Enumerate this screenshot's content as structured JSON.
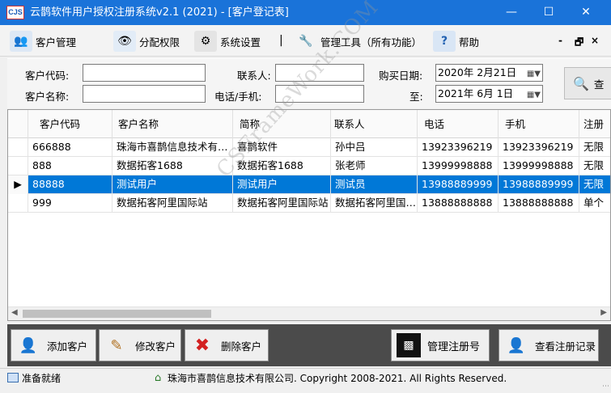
{
  "window": {
    "app_icon": "CJS",
    "title": "云鹊软件用户授权注册系统v2.1 (2021) - [客户登记表]",
    "minimize": "—",
    "maximize": "☐",
    "close": "✕"
  },
  "menu": {
    "items": [
      {
        "label": "客户管理",
        "icon": "users-star-icon"
      },
      {
        "label": "分配权限",
        "icon": "eye-permission-icon"
      },
      {
        "label": "系统设置",
        "icon": "gears-icon"
      },
      {
        "label": "管理工具（所有功能）",
        "icon": "wrench-screwdriver-icon"
      },
      {
        "label": "帮助",
        "icon": "help-book-icon"
      }
    ],
    "separator": "|",
    "mdi_min": "-",
    "mdi_restore": "🗗",
    "mdi_close": "×"
  },
  "search": {
    "customer_code_label": "客户代码:",
    "customer_name_label": "客户名称:",
    "contact_label": "联系人:",
    "phone_label": "电话/手机:",
    "purchase_date_label": "购买日期:",
    "to_label": "至:",
    "date_from": "2020年  2月21日",
    "date_to": "2021年  6月  1日",
    "query_button": "查"
  },
  "grid": {
    "columns": [
      "客户代码",
      "客户名称",
      "简称",
      "联系人",
      "电话",
      "手机",
      "注册"
    ],
    "rows": [
      [
        "666888",
        "珠海市喜鹊信息技术有…",
        "喜鹊软件",
        "孙中吕",
        "13923396219",
        "13923396219",
        "无限"
      ],
      [
        "888",
        "数据拓客1688",
        "数据拓客1688",
        "张老师",
        "13999998888",
        "13999998888",
        "无限"
      ],
      [
        "88888",
        "测试用户",
        "测试用户",
        "测试员",
        "13988889999",
        "13988889999",
        "无限"
      ],
      [
        "999",
        "数据拓客阿里国际站",
        "数据拓客阿里国际站",
        "数据拓客阿里国…",
        "13888888888",
        "13888888888",
        "单个"
      ]
    ],
    "selected_row": 2,
    "row_indicator": "▶",
    "watermark": "CSFrameWork.COM"
  },
  "buttons": {
    "add_customer": "添加客户",
    "edit_customer": "修改客户",
    "delete_customer": "删除客户",
    "manage_reg_no": "管理注册号",
    "view_reg_records": "查看注册记录"
  },
  "status": {
    "ready": "准备就绪",
    "copyright": "珠海市喜鹊信息技术有限公司. Copyright 2008-2021. All Rights Reserved."
  },
  "colors": {
    "titlebar": "#1a73d9",
    "selection": "#0078d7",
    "button_bar": "#4b4b4b"
  }
}
